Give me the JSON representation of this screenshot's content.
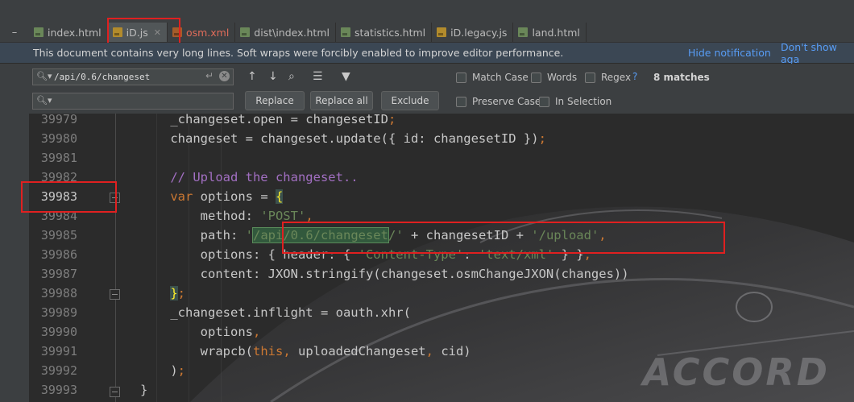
{
  "tabs": [
    {
      "label": "index.html",
      "icon": "html-file-icon",
      "active": false
    },
    {
      "label": "iD.js",
      "icon": "js-file-icon",
      "active": true
    },
    {
      "label": "osm.xml",
      "icon": "xml-file-icon",
      "active": false
    },
    {
      "label": "dist\\index.html",
      "icon": "html-file-icon",
      "active": false
    },
    {
      "label": "statistics.html",
      "icon": "html-file-icon",
      "active": false
    },
    {
      "label": "iD.legacy.js",
      "icon": "js-file-icon",
      "active": false
    },
    {
      "label": "land.html",
      "icon": "html-file-icon",
      "active": false
    }
  ],
  "notification": {
    "text": "This document contains very long lines. Soft wraps were forcibly enabled to improve editor performance.",
    "hide": "Hide notification",
    "dont_show": "Don't show aga"
  },
  "find": {
    "search_value": "/api/0.6/changeset",
    "replace_value": "",
    "replace_label": "Replace",
    "replace_all_label": "Replace all",
    "exclude_label": "Exclude",
    "match_case": "Match Case",
    "words": "Words",
    "regex": "Regex",
    "help": "?",
    "matches": "8 matches",
    "preserve_case": "Preserve Case",
    "in_selection": "In Selection"
  },
  "editor": {
    "current_line": "39983",
    "lines": [
      {
        "num": "39979",
        "code": "    _changeset.open = changesetID;"
      },
      {
        "num": "39980",
        "code": "    changeset = changeset.update({ id: changesetID });"
      },
      {
        "num": "39981",
        "code": ""
      },
      {
        "num": "39982",
        "code": "    // Upload the changeset.."
      },
      {
        "num": "39983",
        "code": "    var options = {"
      },
      {
        "num": "39984",
        "code": "        method: 'POST',"
      },
      {
        "num": "39985",
        "code": "        path: '/api/0.6/changeset/' + changesetID + '/upload',"
      },
      {
        "num": "39986",
        "code": "        options: { header: { 'Content-Type': 'text/xml' } },"
      },
      {
        "num": "39987",
        "code": "        content: JXON.stringify(changeset.osmChangeJXON(changes))"
      },
      {
        "num": "39988",
        "code": "    };"
      },
      {
        "num": "39989",
        "code": "    _changeset.inflight = oauth.xhr("
      },
      {
        "num": "39990",
        "code": "        options,"
      },
      {
        "num": "39991",
        "code": "        wrapcb(this, uploadedChangeset, cid)"
      },
      {
        "num": "39992",
        "code": "    );"
      },
      {
        "num": "39993",
        "code": "}"
      }
    ],
    "watermark": "ACCORD"
  }
}
